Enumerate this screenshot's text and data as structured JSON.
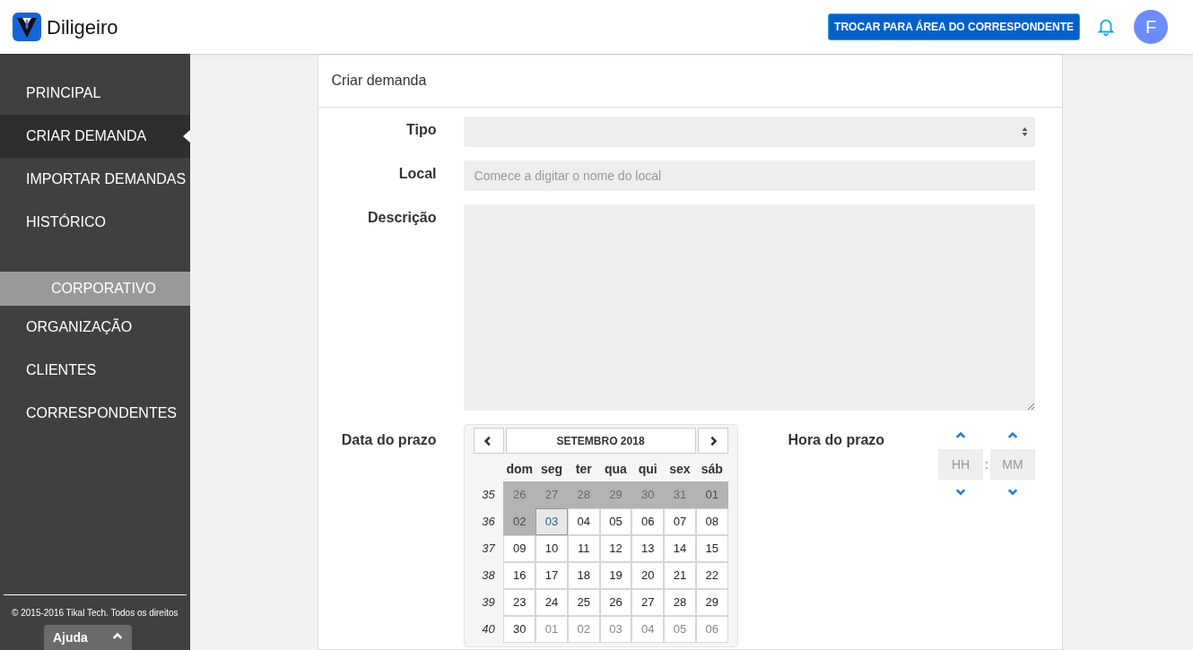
{
  "header": {
    "logo_text": "Diligeiro",
    "switch_button": "TROCAR PARA ÁREA DO CORRESPONDENTE",
    "avatar": "F"
  },
  "sidebar": {
    "items": [
      {
        "label": "PRINCIPAL",
        "selected": false
      },
      {
        "label": "CRIAR DEMANDA",
        "selected": true
      },
      {
        "label": "IMPORTAR DEMANDAS",
        "selected": false
      },
      {
        "label": "HISTÓRICO",
        "selected": false
      }
    ],
    "section": "CORPORATIVO",
    "section_items": [
      {
        "label": "ORGANIZAÇÃO",
        "selected": false
      },
      {
        "label": "CLIENTES",
        "selected": false
      },
      {
        "label": "CORRESPONDENTES",
        "selected": false
      }
    ],
    "footer": "© 2015-2016 Tikal Tech. Todos os direitos",
    "help": "Ajuda"
  },
  "card": {
    "title": "Criar demanda",
    "fields": [
      {
        "label": "Tipo",
        "kind": "select"
      },
      {
        "label": "Local",
        "kind": "text",
        "placeholder": "Comece a digitar o nome do local"
      },
      {
        "label": "Descrição",
        "kind": "textarea"
      }
    ],
    "date_label": "Data do prazo",
    "calendar": {
      "title": "SETEMBRO 2018",
      "weekdays": [
        "dom",
        "seg",
        "ter",
        "qua",
        "qui",
        "sex",
        "sáb"
      ],
      "weeks": [
        {
          "number": "35",
          "days": [
            {
              "day": "26",
              "outside": true,
              "disabled": true,
              "selected": false
            },
            {
              "day": "27",
              "outside": true,
              "disabled": true,
              "selected": false
            },
            {
              "day": "28",
              "outside": true,
              "disabled": true,
              "selected": false
            },
            {
              "day": "29",
              "outside": true,
              "disabled": true,
              "selected": false
            },
            {
              "day": "30",
              "outside": true,
              "disabled": true,
              "selected": false
            },
            {
              "day": "31",
              "outside": true,
              "disabled": true,
              "selected": false
            },
            {
              "day": "01",
              "outside": false,
              "disabled": true,
              "selected": false
            }
          ]
        },
        {
          "number": "36",
          "days": [
            {
              "day": "02",
              "outside": false,
              "disabled": true,
              "selected": false
            },
            {
              "day": "03",
              "outside": false,
              "disabled": false,
              "selected": true
            },
            {
              "day": "04",
              "outside": false,
              "disabled": false,
              "selected": false
            },
            {
              "day": "05",
              "outside": false,
              "disabled": false,
              "selected": false
            },
            {
              "day": "06",
              "outside": false,
              "disabled": false,
              "selected": false
            },
            {
              "day": "07",
              "outside": false,
              "disabled": false,
              "selected": false
            },
            {
              "day": "08",
              "outside": false,
              "disabled": false,
              "selected": false
            }
          ]
        },
        {
          "number": "37",
          "days": [
            {
              "day": "09",
              "outside": false,
              "disabled": false,
              "selected": false
            },
            {
              "day": "10",
              "outside": false,
              "disabled": false,
              "selected": false
            },
            {
              "day": "11",
              "outside": false,
              "disabled": false,
              "selected": false
            },
            {
              "day": "12",
              "outside": false,
              "disabled": false,
              "selected": false
            },
            {
              "day": "13",
              "outside": false,
              "disabled": false,
              "selected": false
            },
            {
              "day": "14",
              "outside": false,
              "disabled": false,
              "selected": false
            },
            {
              "day": "15",
              "outside": false,
              "disabled": false,
              "selected": false
            }
          ]
        },
        {
          "number": "38",
          "days": [
            {
              "day": "16",
              "outside": false,
              "disabled": false,
              "selected": false
            },
            {
              "day": "17",
              "outside": false,
              "disabled": false,
              "selected": false
            },
            {
              "day": "18",
              "outside": false,
              "disabled": false,
              "selected": false
            },
            {
              "day": "19",
              "outside": false,
              "disabled": false,
              "selected": false
            },
            {
              "day": "20",
              "outside": false,
              "disabled": false,
              "selected": false
            },
            {
              "day": "21",
              "outside": false,
              "disabled": false,
              "selected": false
            },
            {
              "day": "22",
              "outside": false,
              "disabled": false,
              "selected": false
            }
          ]
        },
        {
          "number": "39",
          "days": [
            {
              "day": "23",
              "outside": false,
              "disabled": false,
              "selected": false
            },
            {
              "day": "24",
              "outside": false,
              "disabled": false,
              "selected": false
            },
            {
              "day": "25",
              "outside": false,
              "disabled": false,
              "selected": false
            },
            {
              "day": "26",
              "outside": false,
              "disabled": false,
              "selected": false
            },
            {
              "day": "27",
              "outside": false,
              "disabled": false,
              "selected": false
            },
            {
              "day": "28",
              "outside": false,
              "disabled": false,
              "selected": false
            },
            {
              "day": "29",
              "outside": false,
              "disabled": false,
              "selected": false
            }
          ]
        },
        {
          "number": "40",
          "days": [
            {
              "day": "30",
              "outside": false,
              "disabled": false,
              "selected": false
            },
            {
              "day": "01",
              "outside": true,
              "disabled": false,
              "selected": false
            },
            {
              "day": "02",
              "outside": true,
              "disabled": false,
              "selected": false
            },
            {
              "day": "03",
              "outside": true,
              "disabled": false,
              "selected": false
            },
            {
              "day": "04",
              "outside": true,
              "disabled": false,
              "selected": false
            },
            {
              "day": "05",
              "outside": true,
              "disabled": false,
              "selected": false
            },
            {
              "day": "06",
              "outside": true,
              "disabled": false,
              "selected": false
            }
          ]
        }
      ]
    },
    "time_label": "Hora do prazo",
    "time": {
      "hours_placeholder": "HH",
      "separator": ":",
      "minutes_placeholder": "MM"
    }
  }
}
